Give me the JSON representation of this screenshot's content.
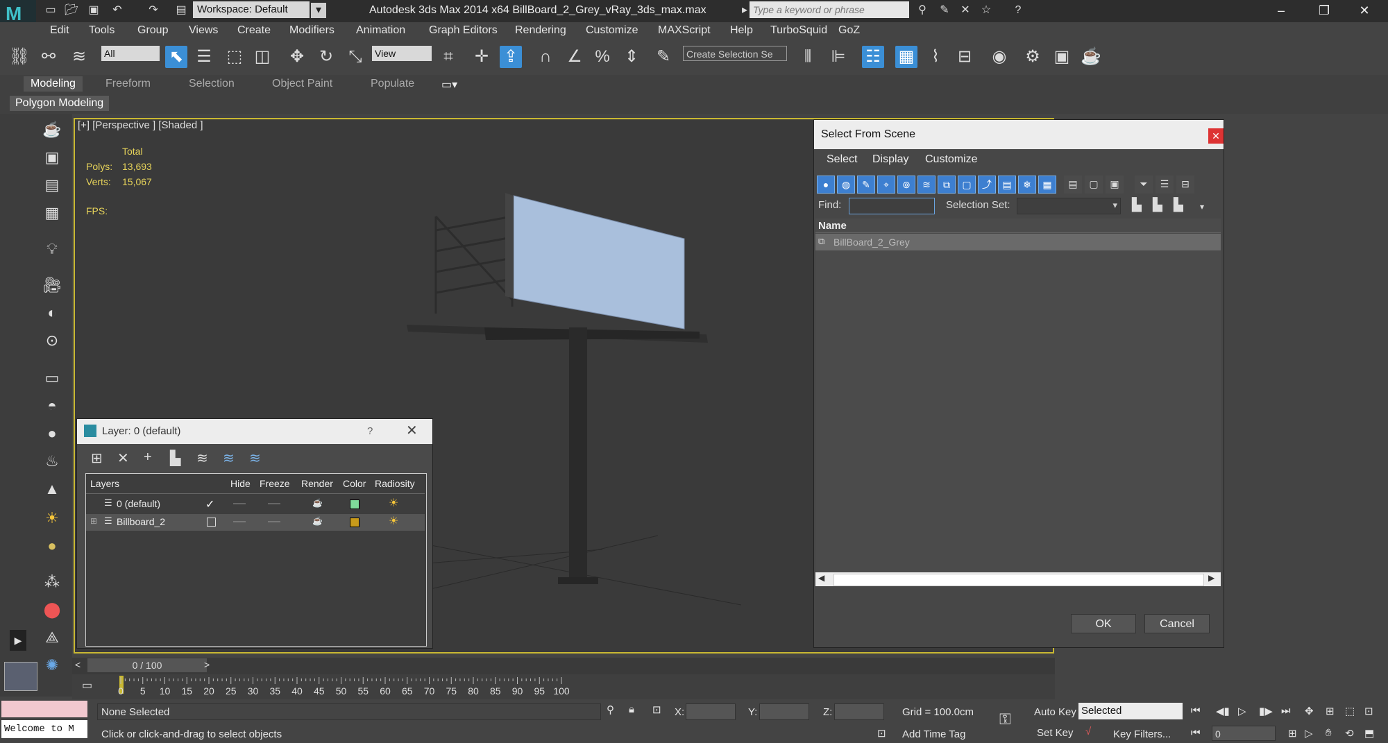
{
  "titlebar": {
    "app_title": "Autodesk 3ds Max  2014 x64      BillBoard_2_Grey_vRay_3ds_max.max",
    "workspace": "Workspace: Default",
    "search_placeholder": "Type a keyword or phrase"
  },
  "menubar": {
    "items": [
      "Edit",
      "Tools",
      "Group",
      "Views",
      "Create",
      "Modifiers",
      "Animation",
      "Graph Editors",
      "Rendering",
      "Customize",
      "MAXScript",
      "Help",
      "TurboSquid",
      "GoZ"
    ]
  },
  "toolbar": {
    "selection_filter": "All",
    "ref_coord": "View",
    "named_selection": "Create Selection Se"
  },
  "ribbon": {
    "tabs": [
      "Modeling",
      "Freeform",
      "Selection",
      "Object Paint",
      "Populate"
    ],
    "panel_label": "Polygon Modeling"
  },
  "viewport": {
    "label": "[+] [Perspective ] [Shaded ]",
    "stats": {
      "total_label": "Total",
      "polys_label": "Polys:",
      "polys_value": "13,693",
      "verts_label": "Verts:",
      "verts_value": "15,067",
      "fps_label": "FPS:"
    }
  },
  "layer_dialog": {
    "title": "Layer: 0 (default)",
    "help": "?",
    "columns": [
      "Layers",
      "Hide",
      "Freeze",
      "Render",
      "Color",
      "Radiosity"
    ],
    "rows": [
      {
        "name": "0 (default)",
        "color": "#7fdc9a",
        "active": true
      },
      {
        "name": "Billboard_2",
        "color": "#c89a1a",
        "active": false
      }
    ]
  },
  "select_from_scene": {
    "title": "Select From Scene",
    "menu": [
      "Select",
      "Display",
      "Customize"
    ],
    "find_label": "Find:",
    "find_value": "",
    "selection_set_label": "Selection Set:",
    "column_name": "Name",
    "items": [
      "BillBoard_2_Grey"
    ],
    "ok_label": "OK",
    "cancel_label": "Cancel"
  },
  "timeline": {
    "frame_counter": "0 / 100",
    "ticks": [
      "0",
      "5",
      "10",
      "15",
      "20",
      "25",
      "30",
      "35",
      "40",
      "45",
      "50",
      "55",
      "60",
      "65",
      "70",
      "75",
      "80",
      "85",
      "90",
      "95",
      "100"
    ]
  },
  "statusbar": {
    "maxscript_text": "Welcome to M",
    "selection_status": "None Selected",
    "prompt": "Click or click-and-drag to select objects",
    "x_label": "X:",
    "y_label": "Y:",
    "z_label": "Z:",
    "grid": "Grid = 100.0cm",
    "add_time_tag": "Add Time Tag",
    "auto_key": "Auto Key",
    "set_key": "Set Key",
    "selected_dd": "Selected",
    "key_filters": "Key Filters...",
    "current_frame": "0"
  },
  "colors": {
    "accent_blue": "#3b8fd6",
    "viewport_border": "#c9b832",
    "stats_text": "#e6d35a",
    "billboard_panel": "#a9bfdc"
  }
}
